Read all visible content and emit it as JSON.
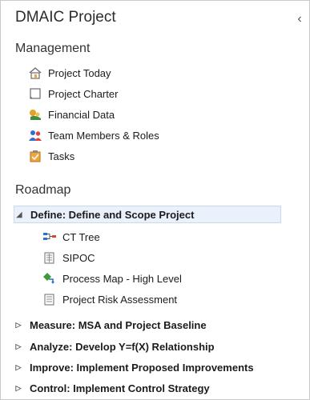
{
  "panel": {
    "title": "DMAIC Project",
    "collapse_glyph": "‹"
  },
  "management": {
    "heading": "Management",
    "items": [
      {
        "label": "Project Today",
        "icon": "house-icon"
      },
      {
        "label": "Project Charter",
        "icon": "document-icon"
      },
      {
        "label": "Financial Data",
        "icon": "coins-icon"
      },
      {
        "label": "Team Members & Roles",
        "icon": "people-icon"
      },
      {
        "label": "Tasks",
        "icon": "tasks-icon"
      }
    ]
  },
  "roadmap": {
    "heading": "Roadmap",
    "phases": [
      {
        "label": "Define:  Define and Scope Project",
        "expanded": true,
        "children": [
          {
            "label": "CT Tree",
            "icon": "ct-tree-icon"
          },
          {
            "label": "SIPOC",
            "icon": "sipoc-icon"
          },
          {
            "label": "Process Map - High Level",
            "icon": "process-map-icon"
          },
          {
            "label": "Project Risk Assessment",
            "icon": "risk-doc-icon"
          }
        ]
      },
      {
        "label": "Measure:  MSA and Project Baseline",
        "expanded": false
      },
      {
        "label": "Analyze:  Develop Y=f(X) Relationship",
        "expanded": false
      },
      {
        "label": "Improve:  Implement Proposed Improvements",
        "expanded": false
      },
      {
        "label": "Control:  Implement Control Strategy",
        "expanded": false
      }
    ]
  },
  "arrows": {
    "expanded": "◢",
    "collapsed": "▷"
  },
  "colors": {
    "selected_bg": "#eaf1fb",
    "selected_border": "#c7d8f0"
  }
}
